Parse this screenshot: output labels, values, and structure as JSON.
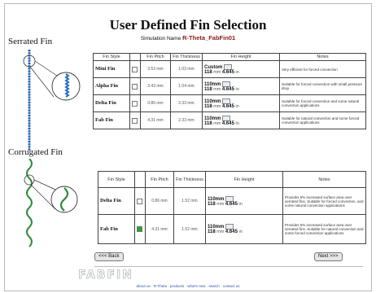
{
  "header": {
    "title": "User Defined Fin Selection",
    "sim_label": "Simulation Name",
    "sim_name": "R-Theta_FabFin01"
  },
  "serrated": {
    "heading": "Serrated Fin",
    "columns": [
      "Fin Style",
      "",
      "Fin Pitch",
      "Fin Thickness",
      "Fin Height",
      "Notes"
    ],
    "rows": [
      {
        "name": "Mini Fin",
        "checked": false,
        "pitch": "3.53 mm",
        "thickness": "1.03 mm",
        "h1": "Custom",
        "h2": "118",
        "h2_unit": "mm",
        "h3": "4.645",
        "h3_unit": "in",
        "notes": "Very efficient for forced convection"
      },
      {
        "name": "Alpha Fin",
        "checked": false,
        "pitch": "3.43 mm",
        "thickness": "1.04 mm",
        "h1": "110mm",
        "h2": "118",
        "h2_unit": "mm",
        "h3": "4.645",
        "h3_unit": "in",
        "notes": "Suitable for forced convection with small pressure drop"
      },
      {
        "name": "Delta Fin",
        "checked": false,
        "pitch": "0.86 mm",
        "thickness": "2.33 mm",
        "h1": "110mm",
        "h2": "118",
        "h2_unit": "mm",
        "h3": "4.645",
        "h3_unit": "in",
        "notes": "Suitable for forced convection and some natural convection applications"
      },
      {
        "name": "Fab Fin",
        "checked": false,
        "pitch": "4.31 mm",
        "thickness": "2.33 mm",
        "h1": "110mm",
        "h2": "118",
        "h2_unit": "mm",
        "h3": "4.645",
        "h3_unit": "in",
        "notes": "Suitable for natural convection and some forced convection applications"
      }
    ]
  },
  "corrugated": {
    "heading": "Corrugated Fin",
    "columns": [
      "Fin Style",
      "",
      "Fin Pitch",
      "Fin Thickness",
      "Fin Height",
      "Notes"
    ],
    "rows": [
      {
        "name": "Delta Fin",
        "checked": false,
        "pitch": "0.86 mm",
        "thickness": "1.52 mm",
        "h1": "110mm",
        "h2": "118",
        "h2_unit": "mm",
        "h3": "4.645",
        "h3_unit": "in",
        "notes": "Provides 5% increased surface area over serrated fins. Suitable for forced convection, and some natural convection applications"
      },
      {
        "name": "Fab Fin",
        "checked": true,
        "pitch": "4.31 mm",
        "thickness": "1.52 mm",
        "h1": "110mm",
        "h2": "118",
        "h2_unit": "mm",
        "h3": "4.645",
        "h3_unit": "in",
        "notes": "Provides 5% increased surface area over serrated fins. Suitable for natural convection and some forced convection applications"
      }
    ]
  },
  "nav": {
    "back": "<<< Back",
    "next": "Next >>>"
  },
  "logo": "FABFIN",
  "footer": "about us · R-Theta · products · what's new · search · contact us"
}
